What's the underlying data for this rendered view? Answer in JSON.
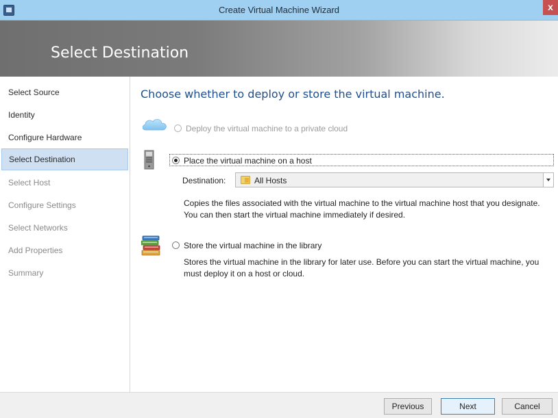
{
  "window": {
    "title": "Create Virtual Machine Wizard",
    "close_glyph": "x"
  },
  "header": {
    "page_title": "Select Destination"
  },
  "sidebar": {
    "steps": [
      {
        "label": "Select Source",
        "state": "completed"
      },
      {
        "label": "Identity",
        "state": "completed"
      },
      {
        "label": "Configure Hardware",
        "state": "completed"
      },
      {
        "label": "Select Destination",
        "state": "active"
      },
      {
        "label": "Select Host",
        "state": "disabled"
      },
      {
        "label": "Configure Settings",
        "state": "disabled"
      },
      {
        "label": "Select Networks",
        "state": "disabled"
      },
      {
        "label": "Add Properties",
        "state": "disabled"
      },
      {
        "label": "Summary",
        "state": "disabled"
      }
    ]
  },
  "main": {
    "heading": "Choose whether to deploy or store the virtual machine.",
    "options": {
      "cloud": {
        "label": "Deploy the virtual machine to a private cloud",
        "icon": "cloud-icon",
        "enabled": false,
        "selected": false
      },
      "host": {
        "label": "Place the virtual machine on a host",
        "icon": "server-icon",
        "enabled": true,
        "selected": true,
        "destination_label": "Destination:",
        "destination_value": "All Hosts",
        "description": "Copies the files associated with the virtual machine to the virtual machine host that you designate. You can then start the virtual machine immediately if desired."
      },
      "library": {
        "label": "Store the virtual machine in the library",
        "icon": "books-icon",
        "enabled": true,
        "selected": false,
        "description": "Stores the virtual machine in the library for later use. Before you can start the virtual machine, you must deploy it on a host or cloud."
      }
    }
  },
  "footer": {
    "previous_label": "Previous",
    "next_label": "Next",
    "cancel_label": "Cancel"
  },
  "colors": {
    "title_bar": "#9fd0f1",
    "heading": "#1f4e8c",
    "active_step": "#cfe0f3",
    "close_button": "#c75050"
  }
}
